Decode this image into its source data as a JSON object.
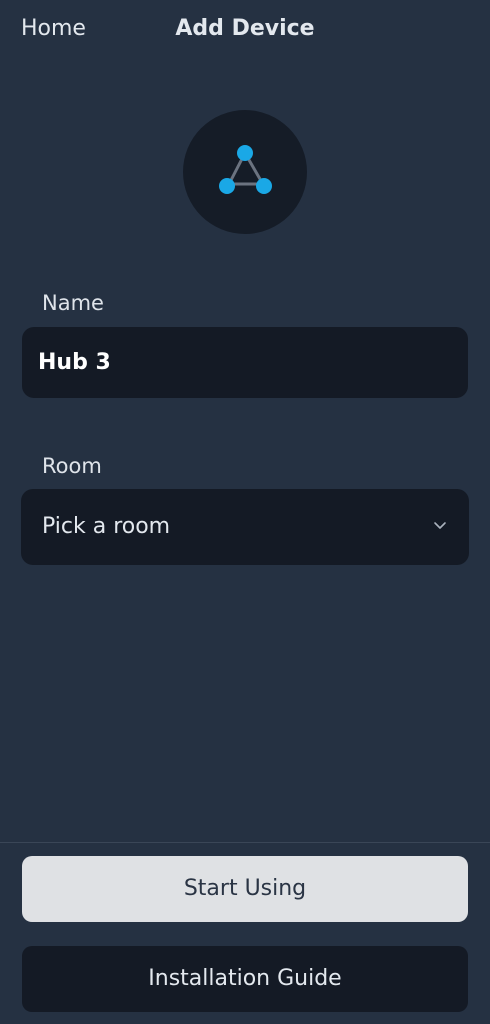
{
  "header": {
    "back_label": "Home",
    "title": "Add Device"
  },
  "device": {
    "icon": "hub-network-icon",
    "accent_color": "#1aa8e6"
  },
  "form": {
    "name_label": "Name",
    "name_value": "Hub 3",
    "room_label": "Room",
    "room_placeholder": "Pick a room"
  },
  "actions": {
    "primary_label": "Start Using",
    "secondary_label": "Installation Guide"
  }
}
